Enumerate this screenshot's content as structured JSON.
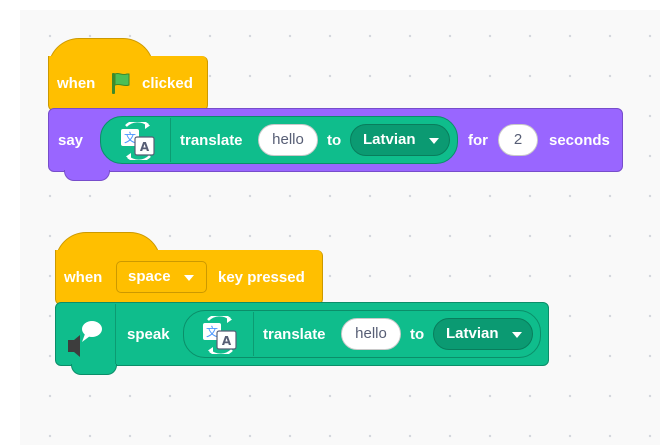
{
  "script1": {
    "hat": {
      "when_label": "when",
      "clicked_label": "clicked",
      "flag_icon": "green-flag-icon"
    },
    "say": {
      "say_label": "say",
      "translate_label": "translate",
      "text_value": "hello",
      "to_label": "to",
      "language_value": "Latvian",
      "for_label": "for",
      "secs_value": "2",
      "seconds_label": "seconds"
    }
  },
  "script2": {
    "hat": {
      "when_label": "when",
      "key_value": "space",
      "key_pressed_label": "key pressed"
    },
    "speak": {
      "speak_label": "speak",
      "translate_label": "translate",
      "text_value": "hello",
      "to_label": "to",
      "language_value": "Latvian",
      "icon": "text-to-speech-icon"
    }
  },
  "colors": {
    "events": "#ffbf00",
    "looks": "#9966ff",
    "extension": "#0fbd8c",
    "workspace": "#f9f9f9"
  }
}
